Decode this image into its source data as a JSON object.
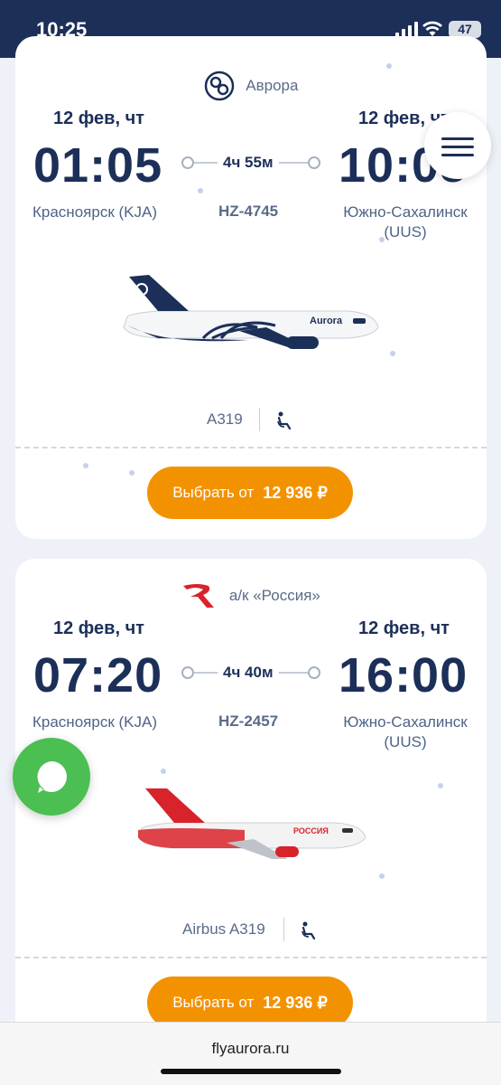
{
  "status_bar": {
    "time": "10:25",
    "battery": "47"
  },
  "flights": [
    {
      "airline": "Аврора",
      "dep_date": "12 фев, чт",
      "dep_time": "01:05",
      "dep_city": "Красноярск (KJA)",
      "arr_date": "12 фев, чт",
      "arr_time": "10:05",
      "arr_city_line1": "Южно-Сахалинск",
      "arr_city_line2": "(UUS)",
      "duration": "4ч 55м",
      "flight_no": "HZ-4745",
      "aircraft": "A319",
      "select_label": "Выбрать от",
      "price": "12 936 ₽"
    },
    {
      "airline": "а/к «Россия»",
      "dep_date": "12 фев, чт",
      "dep_time": "07:20",
      "dep_city": "Красноярск (KJA)",
      "arr_date": "12 фев, чт",
      "arr_time": "16:00",
      "arr_city_line1": "Южно-Сахалинск",
      "arr_city_line2": "(UUS)",
      "duration": "4ч 40м",
      "flight_no": "HZ-2457",
      "aircraft": "Airbus A319",
      "select_label": "Выбрать от",
      "price": "12 936 ₽"
    }
  ],
  "address_bar": {
    "url": "flyaurora.ru"
  },
  "colors": {
    "navy": "#1c2f58",
    "orange": "#f39200",
    "chat_green": "#4bbf52",
    "rossiya_red": "#d8232a"
  }
}
